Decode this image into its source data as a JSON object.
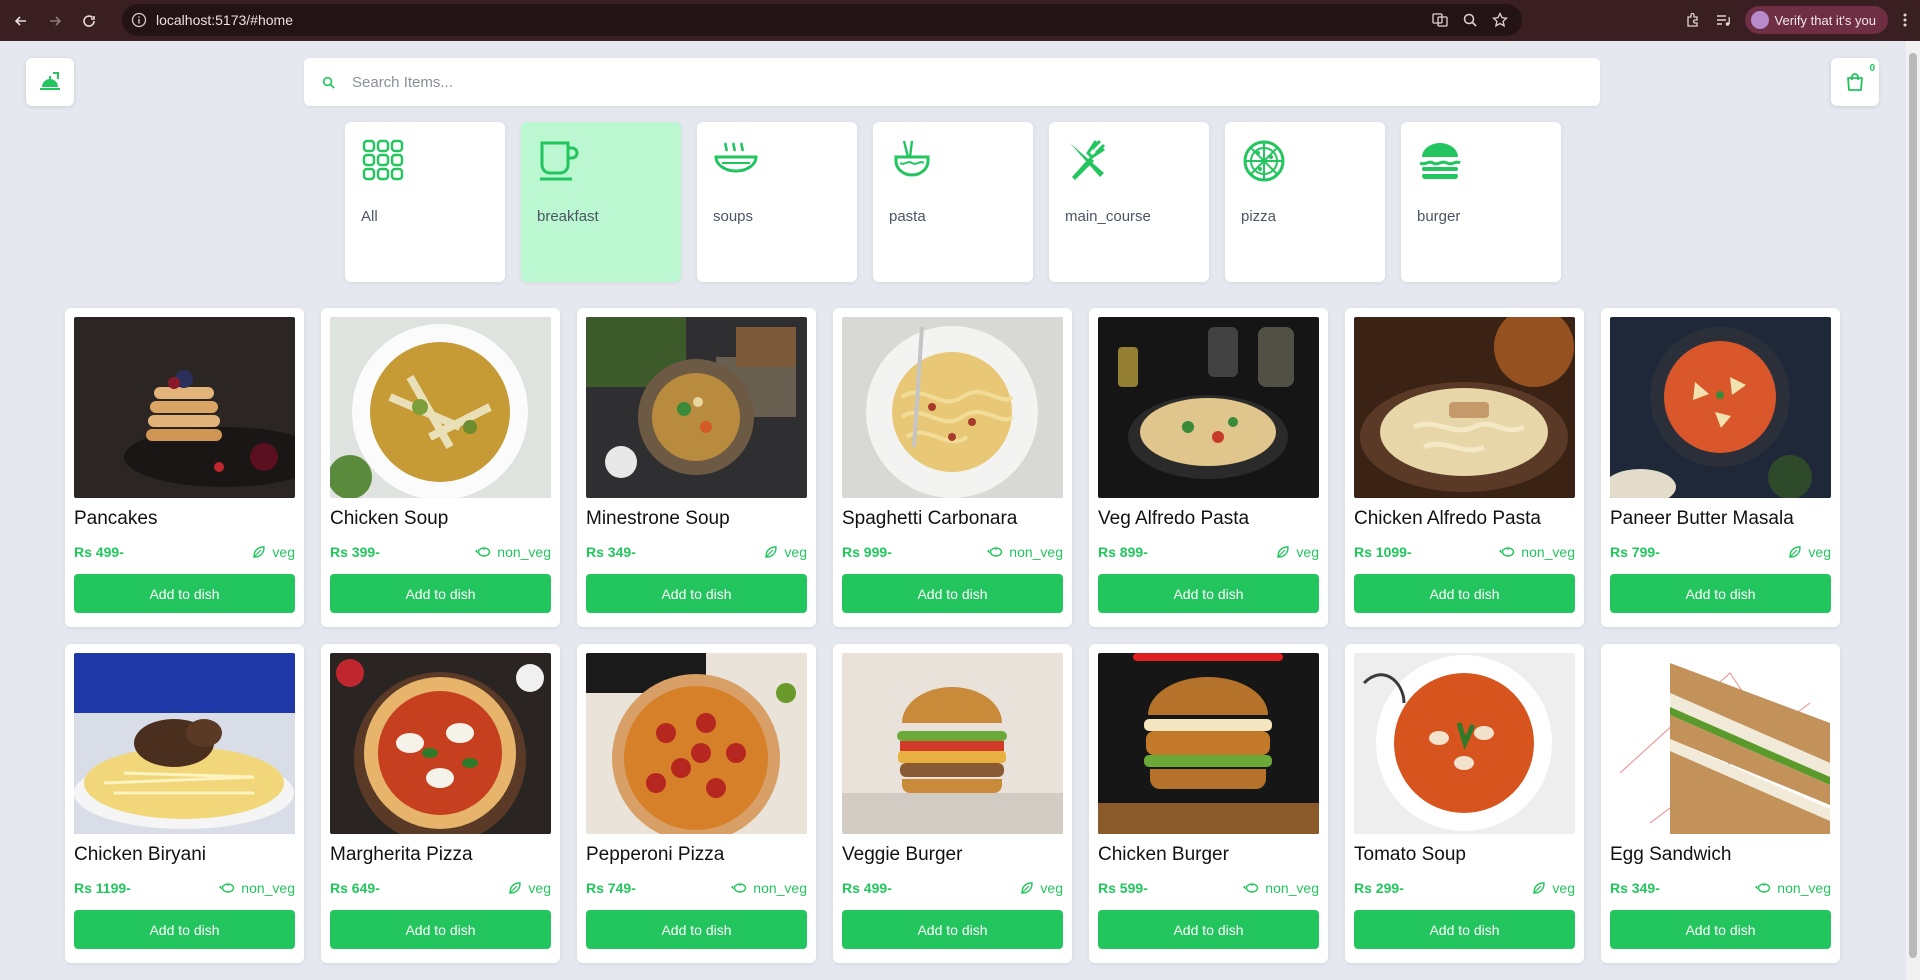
{
  "browser": {
    "url": "localhost:5173/#home",
    "profile_label": "Verify that it's you"
  },
  "app": {
    "search_placeholder": "Search Items...",
    "cart_count": "0"
  },
  "categories": [
    {
      "label": "All",
      "icon": "grid-icon",
      "active": false
    },
    {
      "label": "breakfast",
      "icon": "coffee-cup-icon",
      "active": true
    },
    {
      "label": "soups",
      "icon": "soup-bowl-icon",
      "active": false
    },
    {
      "label": "pasta",
      "icon": "noodles-icon",
      "active": false
    },
    {
      "label": "main_course",
      "icon": "fork-knife-icon",
      "active": false
    },
    {
      "label": "pizza",
      "icon": "pizza-icon",
      "active": false
    },
    {
      "label": "burger",
      "icon": "burger-icon",
      "active": false
    }
  ],
  "items": [
    {
      "name": "Pancakes",
      "price": "Rs 499-",
      "type": "veg",
      "button": "Add to dish",
      "photo": "pancakes"
    },
    {
      "name": "Chicken Soup",
      "price": "Rs 399-",
      "type": "non_veg",
      "button": "Add to dish",
      "photo": "soup-light"
    },
    {
      "name": "Minestrone Soup",
      "price": "Rs 349-",
      "type": "veg",
      "button": "Add to dish",
      "photo": "soup-dark"
    },
    {
      "name": "Spaghetti Carbonara",
      "price": "Rs 999-",
      "type": "non_veg",
      "button": "Add to dish",
      "photo": "pasta-light"
    },
    {
      "name": "Veg Alfredo Pasta",
      "price": "Rs 899-",
      "type": "veg",
      "button": "Add to dish",
      "photo": "pasta-dark"
    },
    {
      "name": "Chicken Alfredo Pasta",
      "price": "Rs 1099-",
      "type": "non_veg",
      "button": "Add to dish",
      "photo": "pasta-warm"
    },
    {
      "name": "Paneer Butter Masala",
      "price": "Rs 799-",
      "type": "veg",
      "button": "Add to dish",
      "photo": "curry"
    },
    {
      "name": "Chicken Biryani",
      "price": "Rs 1199-",
      "type": "non_veg",
      "button": "Add to dish",
      "photo": "biryani"
    },
    {
      "name": "Margherita Pizza",
      "price": "Rs 649-",
      "type": "veg",
      "button": "Add to dish",
      "photo": "pizza-dark"
    },
    {
      "name": "Pepperoni Pizza",
      "price": "Rs 749-",
      "type": "non_veg",
      "button": "Add to dish",
      "photo": "pizza-warm"
    },
    {
      "name": "Veggie Burger",
      "price": "Rs 499-",
      "type": "veg",
      "button": "Add to dish",
      "photo": "burger-light"
    },
    {
      "name": "Chicken Burger",
      "price": "Rs 599-",
      "type": "non_veg",
      "button": "Add to dish",
      "photo": "burger-dark"
    },
    {
      "name": "Tomato Soup",
      "price": "Rs 299-",
      "type": "veg",
      "button": "Add to dish",
      "photo": "tomato-soup"
    },
    {
      "name": "Egg Sandwich",
      "price": "Rs 349-",
      "type": "non_veg",
      "button": "Add to dish",
      "photo": "sandwich"
    }
  ],
  "colors": {
    "accent": "#22c55e",
    "active_category_bg": "#bbf7d0",
    "page_bg": "#e5e8ef",
    "chrome_bg": "#3a1f22"
  }
}
